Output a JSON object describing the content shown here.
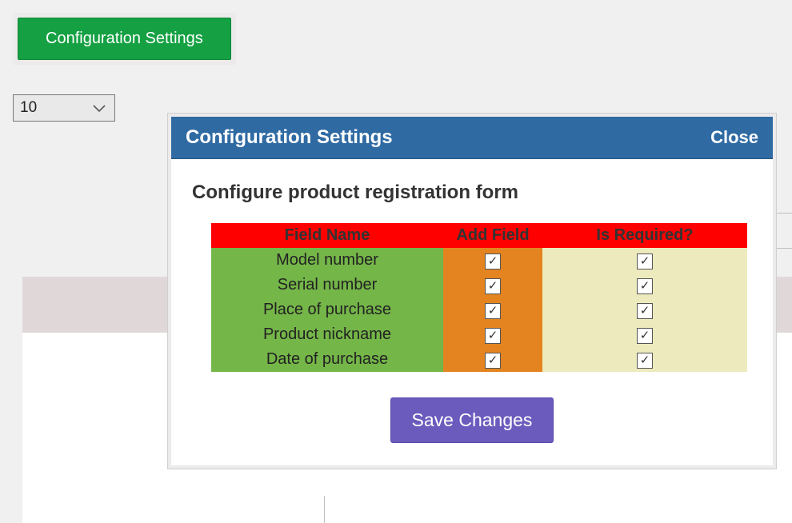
{
  "top_button": {
    "label": "Configuration Settings"
  },
  "page_size_select": {
    "value": "10"
  },
  "modal": {
    "title": "Configuration Settings",
    "close_label": "Close",
    "subtitle": "Configure product registration form",
    "table": {
      "headers": {
        "field_name": "Field Name",
        "add_field": "Add Field",
        "is_required": "Is Required?"
      },
      "rows": [
        {
          "name": "Model number",
          "add": true,
          "required": true
        },
        {
          "name": "Serial number",
          "add": true,
          "required": true
        },
        {
          "name": "Place of purchase",
          "add": true,
          "required": true
        },
        {
          "name": "Product nickname",
          "add": true,
          "required": true
        },
        {
          "name": "Date of purchase",
          "add": true,
          "required": true
        }
      ]
    },
    "save_label": "Save Changes"
  }
}
